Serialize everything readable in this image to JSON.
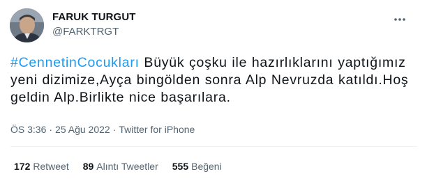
{
  "author": {
    "name": "FARUK TURGUT",
    "handle": "@FARKTRGT"
  },
  "tweet": {
    "hashtag": "#CennetinCocukları",
    "body": " Büyük çoşku ile hazırlıklarını yaptığımız yeni dizimize,Ayça bingölden sonra Alp Nevruzda katıldı.Hoş geldin Alp.Birlikte nice başarılara.",
    "time": "ÖS 3:36",
    "separator": "·",
    "date": "25 Ağu 2022",
    "source": "Twitter for iPhone"
  },
  "stats": {
    "retweets_count": "172",
    "retweets_label": "Retweet",
    "quotes_count": "89",
    "quotes_label": "Alıntı Tweetler",
    "likes_count": "555",
    "likes_label": "Beğeni"
  },
  "colors": {
    "accent": "#1d9bf0",
    "text": "#0f1419",
    "muted": "#536471",
    "divider": "#eff3f4"
  },
  "icons": {
    "more": "more-horizontal-icon"
  }
}
